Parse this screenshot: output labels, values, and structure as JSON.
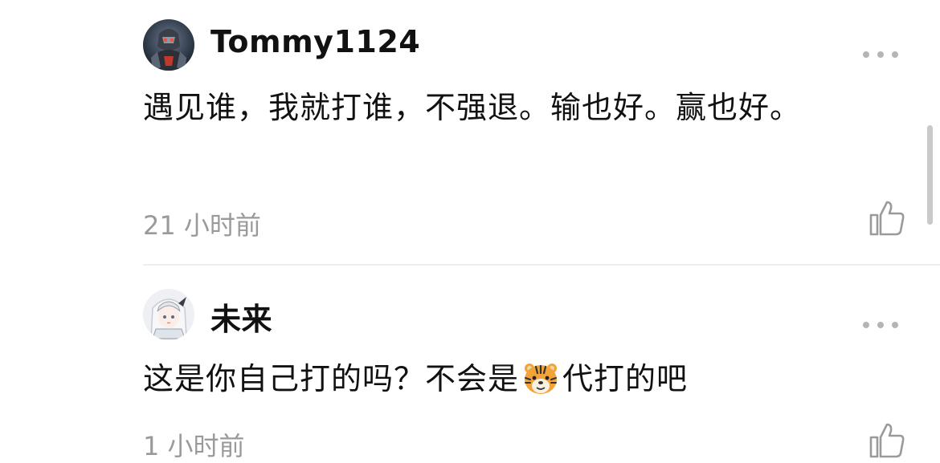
{
  "comments": [
    {
      "username": "Tommy1124",
      "avatar_icon": "armored-robot-avatar",
      "text": "遇见谁，我就打谁，不强退。输也好。赢也好。",
      "time": "21 小时前",
      "more_icon": "more-dots-icon",
      "like_icon": "thumbs-up-icon"
    },
    {
      "username": "未来",
      "avatar_icon": "anime-girl-avatar",
      "text_before_emoji": "这是你自己打的吗？不会是",
      "emoji": "tiger-face-emoji",
      "text_after_emoji": "代打的吧",
      "time": "1 小时前",
      "more_icon": "more-dots-icon",
      "like_icon": "thumbs-up-icon"
    }
  ],
  "colors": {
    "text": "#111111",
    "time": "#9a9a9a",
    "icon": "#b5b5b5",
    "divider": "#eeeeee",
    "scrollbar": "#c9c9c9"
  }
}
